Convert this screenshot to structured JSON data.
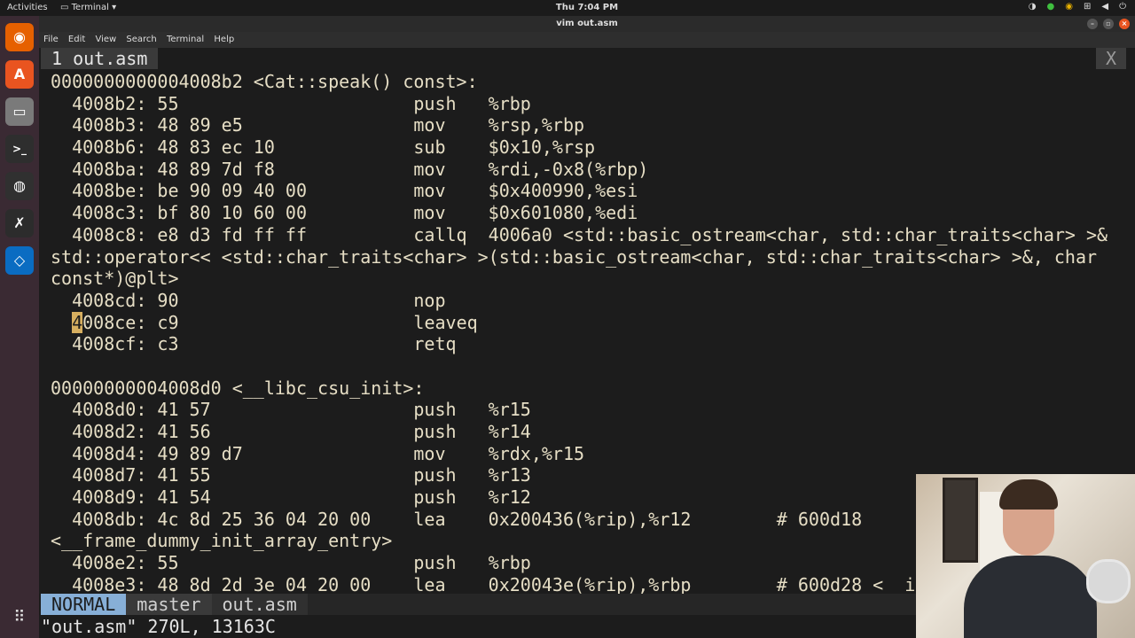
{
  "topbar": {
    "activities": "Activities",
    "app_name": "Terminal ▾",
    "clock": "Thu  7:04 PM",
    "tray_icons": [
      "steam-icon",
      "updates-icon",
      "chrome-icon",
      "network-icon",
      "volume-icon",
      "power-icon"
    ]
  },
  "dock": {
    "items": [
      {
        "icon": "firefox-icon",
        "glyph": "◉",
        "color": "#e66000"
      },
      {
        "icon": "software-center-icon",
        "glyph": "A",
        "color": "#e95420"
      },
      {
        "icon": "files-icon",
        "glyph": "▭",
        "color": "#7a7a7a"
      },
      {
        "icon": "terminal-icon",
        "glyph": ">_",
        "color": "#2e2e2e"
      },
      {
        "icon": "obs-icon",
        "glyph": "◍",
        "color": "#303030"
      },
      {
        "icon": "calc-icon",
        "glyph": "✗",
        "color": "#2c2c2c"
      },
      {
        "icon": "vscode-icon",
        "glyph": "◇",
        "color": "#0a6cc2"
      }
    ],
    "apps_grid_glyph": "⠿"
  },
  "window": {
    "title": "vim out.asm",
    "menu": [
      "File",
      "Edit",
      "View",
      "Search",
      "Terminal",
      "Help"
    ]
  },
  "vim": {
    "tab_label": "1 out.asm",
    "tab_close": "X",
    "lines": [
      "0000000000004008b2 <Cat::speak() const>:",
      "  4008b2: 55                      push   %rbp",
      "  4008b3: 48 89 e5                mov    %rsp,%rbp",
      "  4008b6: 48 83 ec 10             sub    $0x10,%rsp",
      "  4008ba: 48 89 7d f8             mov    %rdi,-0x8(%rbp)",
      "  4008be: be 90 09 40 00          mov    $0x400990,%esi",
      "  4008c3: bf 80 10 60 00          mov    $0x601080,%edi",
      "  4008c8: e8 d3 fd ff ff          callq  4006a0 <std::basic_ostream<char, std::char_traits<char> >&",
      "std::operator<< <std::char_traits<char> >(std::basic_ostream<char, std::char_traits<char> >&, char",
      "const*)@plt>",
      "  4008cd: 90                      nop",
      "  4008ce: c9                      leaveq",
      "  4008cf: c3                      retq",
      "",
      "00000000004008d0 <__libc_csu_init>:",
      "  4008d0: 41 57                   push   %r15",
      "  4008d2: 41 56                   push   %r14",
      "  4008d4: 49 89 d7                mov    %rdx,%r15",
      "  4008d7: 41 55                   push   %r13",
      "  4008d9: 41 54                   push   %r12",
      "  4008db: 4c 8d 25 36 04 20 00    lea    0x200436(%rip),%r12        # 600d18",
      "<__frame_dummy_init_array_entry>",
      "  4008e2: 55                      push   %rbp",
      "  4008e3: 48 8d 2d 3e 04 20 00    lea    0x20043e(%rip),%rbp        # 600d28 <__init"
    ],
    "cursor_line_prefix": "  ",
    "cursor_char": "4",
    "cursor_line_rest": "008ce: c9                      leaveq",
    "status": {
      "mode": "NORMAL",
      "branch": "master",
      "file": "out.asm"
    },
    "cmdline": "\"out.asm\" 270L, 13163C"
  }
}
